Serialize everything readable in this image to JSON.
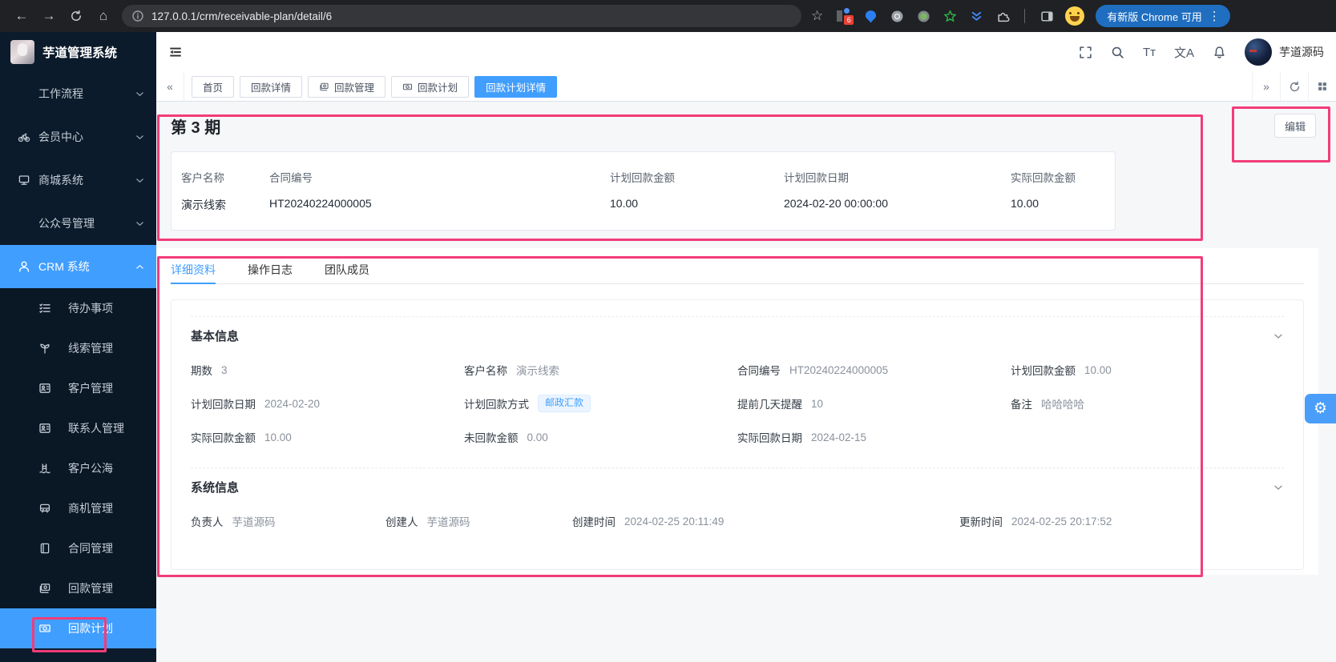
{
  "browser": {
    "url": "127.0.0.1/crm/receivable-plan/detail/6",
    "update_button": "有新版 Chrome 可用",
    "extension_badge": "6"
  },
  "header": {
    "brand": "芋道管理系统",
    "username": "芋道源码",
    "font_size_tool": "Tт",
    "locale_tool": "文A"
  },
  "tabbar": {
    "tabs": [
      {
        "label": "首页"
      },
      {
        "label": "回款详情"
      },
      {
        "label": "回款管理"
      },
      {
        "label": "回款计划"
      },
      {
        "label": "回款计划详情"
      }
    ]
  },
  "sidebar": {
    "items": [
      {
        "label": "工作流程",
        "icon": ""
      },
      {
        "label": "会员中心",
        "icon": "bicycle-icon"
      },
      {
        "label": "商城系统",
        "icon": "storefront-icon"
      },
      {
        "label": "公众号管理",
        "icon": ""
      },
      {
        "label": "CRM 系统",
        "icon": "user-icon"
      }
    ],
    "sub_items": [
      {
        "label": "待办事项",
        "icon": "todo-list-icon"
      },
      {
        "label": "线索管理",
        "icon": "sprout-icon"
      },
      {
        "label": "客户管理",
        "icon": "contact-card-icon"
      },
      {
        "label": "联系人管理",
        "icon": "contacts-icon"
      },
      {
        "label": "客户公海",
        "icon": "pool-icon"
      },
      {
        "label": "商机管理",
        "icon": "bus-icon"
      },
      {
        "label": "合同管理",
        "icon": "contract-icon"
      },
      {
        "label": "回款管理",
        "icon": "payment-card-icon"
      },
      {
        "label": "回款计划",
        "icon": "banknote-icon"
      }
    ]
  },
  "page": {
    "title": "第 3 期",
    "edit_button": "编辑",
    "summary_columns": [
      {
        "label": "客户名称",
        "value": "演示线索"
      },
      {
        "label": "合同编号",
        "value": "HT20240224000005"
      },
      {
        "label": "计划回款金额",
        "value": "10.00"
      },
      {
        "label": "计划回款日期",
        "value": "2024-02-20 00:00:00"
      },
      {
        "label": "实际回款金额",
        "value": "10.00"
      }
    ],
    "detail_tabs": [
      {
        "label": "详细资料"
      },
      {
        "label": "操作日志"
      },
      {
        "label": "团队成员"
      }
    ],
    "basic_info": {
      "title": "基本信息",
      "cells": [
        {
          "label": "期数",
          "value": "3"
        },
        {
          "label": "客户名称",
          "value": "演示线索"
        },
        {
          "label": "合同编号",
          "value": "HT20240224000005"
        },
        {
          "label": "计划回款金额",
          "value": "10.00"
        },
        {
          "label": "计划回款日期",
          "value": "2024-02-20"
        },
        {
          "label": "计划回款方式",
          "value": "邮政汇款"
        },
        {
          "label": "提前几天提醒",
          "value": "10"
        },
        {
          "label": "备注",
          "value": "哈哈哈哈"
        },
        {
          "label": "实际回款金额",
          "value": "10.00"
        },
        {
          "label": "未回款金额",
          "value": "0.00"
        },
        {
          "label": "实际回款日期",
          "value": "2024-02-15"
        }
      ]
    },
    "system_info": {
      "title": "系统信息",
      "cells": [
        {
          "label": "负责人",
          "value": "芋道源码"
        },
        {
          "label": "创建人",
          "value": "芋道源码"
        },
        {
          "label": "创建时间",
          "value": "2024-02-25 20:11:49"
        },
        {
          "label": "更新时间",
          "value": "2024-02-25 20:17:52"
        }
      ]
    }
  },
  "colors": {
    "accent": "#409eff",
    "annotation": "#f23c78",
    "sidebar_bg": "#0c1b2b",
    "tag_bg": "#ecf5ff",
    "tag_text": "#409eff"
  }
}
